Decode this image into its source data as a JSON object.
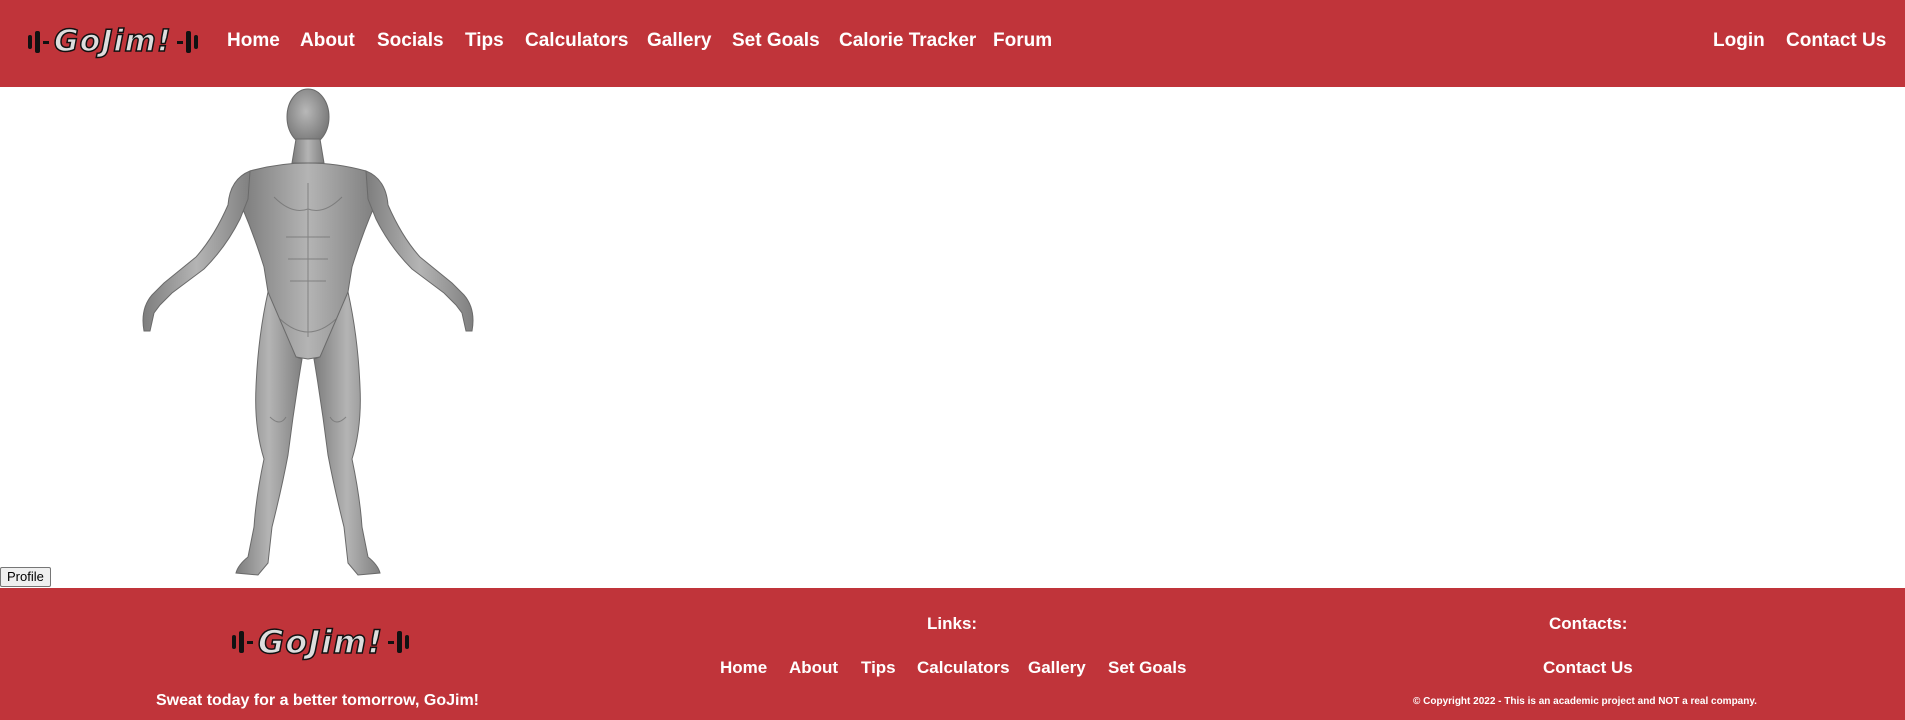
{
  "header": {
    "logo_text": "GoJim!",
    "nav": [
      {
        "label": "Home"
      },
      {
        "label": "About"
      },
      {
        "label": "Socials"
      },
      {
        "label": "Tips"
      },
      {
        "label": "Calculators"
      },
      {
        "label": "Gallery"
      },
      {
        "label": "Set Goals"
      },
      {
        "label": "Calorie Tracker"
      },
      {
        "label": "Forum"
      }
    ],
    "right_nav": [
      {
        "label": "Login"
      },
      {
        "label": "Contact Us"
      }
    ]
  },
  "main": {
    "profile_button_label": "Profile"
  },
  "footer": {
    "logo_text": "GoJim!",
    "tagline": "Sweat today for a better tomorrow, GoJim!",
    "links_heading": "Links:",
    "links": [
      {
        "label": "Home"
      },
      {
        "label": "About"
      },
      {
        "label": "Tips"
      },
      {
        "label": "Calculators"
      },
      {
        "label": "Gallery"
      },
      {
        "label": "Set Goals"
      }
    ],
    "contacts_heading": "Contacts:",
    "contact_link": "Contact Us",
    "copyright": "© Copyright 2022 - This is an academic project and NOT a real company."
  },
  "colors": {
    "brand_red": "#c0343a",
    "text_white": "#ffffff"
  }
}
